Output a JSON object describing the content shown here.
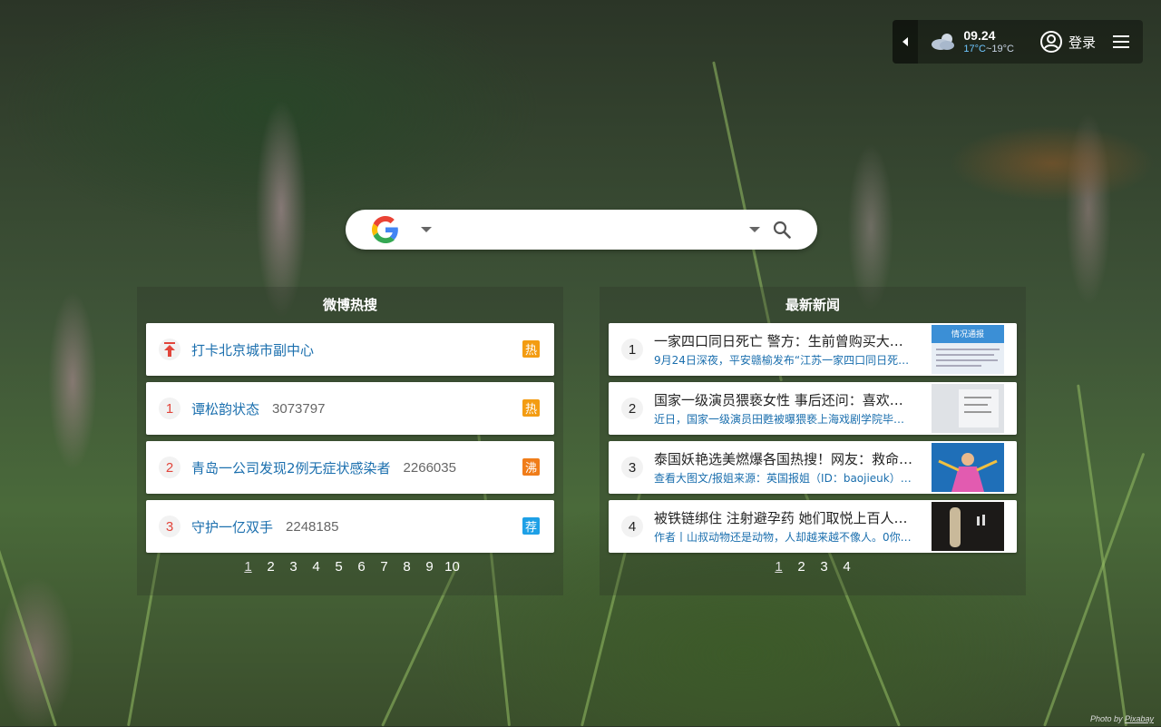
{
  "weather": {
    "date": "09.24",
    "temp_low": "17°C",
    "temp_sep": "~",
    "temp_high": "19°C",
    "icon": "cloudy-icon"
  },
  "header": {
    "login_label": "登录"
  },
  "search": {
    "engine": "Google",
    "placeholder": "",
    "value": ""
  },
  "weibo": {
    "title": "微博热搜",
    "items": [
      {
        "rank": "",
        "title": "打卡北京城市副中心",
        "count": "",
        "badge": "热",
        "badge_color": "#f39c12"
      },
      {
        "rank": "1",
        "title": "谭松韵状态",
        "count": "3073797",
        "badge": "热",
        "badge_color": "#f39c12"
      },
      {
        "rank": "2",
        "title": "青岛一公司发现2例无症状感染者",
        "count": "2266035",
        "badge": "沸",
        "badge_color": "#f07d1a"
      },
      {
        "rank": "3",
        "title": "守护一亿双手",
        "count": "2248185",
        "badge": "荐",
        "badge_color": "#1ea0e6"
      }
    ],
    "pages": [
      "1",
      "2",
      "3",
      "4",
      "5",
      "6",
      "7",
      "8",
      "9",
      "10"
    ],
    "active_page": "1"
  },
  "news": {
    "title": "最新新闻",
    "items": [
      {
        "rank": "1",
        "title": "一家四口同日死亡 警方：生前曾购买大…",
        "sub": "9月24日深夜，平安赣榆发布“江苏一家四口同日死…",
        "thumb_text": "情况通报"
      },
      {
        "rank": "2",
        "title": "国家一级演员猥亵女性 事后还问：喜欢…",
        "sub": "近日，国家一级演员田甦被曝猥亵上海戏剧学院毕…",
        "thumb_text": ""
      },
      {
        "rank": "3",
        "title": "泰国妖艳选美燃爆各国热搜！网友：救命…",
        "sub": "查看大图文/报姐来源：英国报姐（ID：baojieuk）…",
        "thumb_text": ""
      },
      {
        "rank": "4",
        "title": "被铁链绑住 注射避孕药 她们取悦上百人…",
        "sub": "作者丨山叔动物还是动物，人却越来越不像人。0你…",
        "thumb_text": ""
      }
    ],
    "pages": [
      "1",
      "2",
      "3",
      "4"
    ],
    "active_page": "1"
  },
  "credit": {
    "prefix": "Photo by ",
    "link": "Pixabay"
  }
}
